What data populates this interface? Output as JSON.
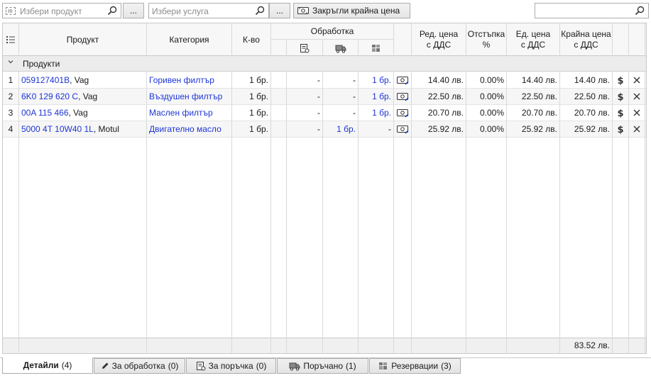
{
  "toolbar": {
    "product_placeholder": "Избери продукт",
    "product_browse_label": "...",
    "service_placeholder": "Избери услуга",
    "service_browse_label": "...",
    "round_price_label": "Закръгли крайна цена",
    "search_value": ""
  },
  "grid": {
    "headers": {
      "product": "Продукт",
      "category": "Категория",
      "qty": "К-во",
      "processing": "Обработка",
      "regular_price": "Ред. цена\nс ДДС",
      "discount": "Отстъпка\n%",
      "unit_price": "Ед. цена\nс ДДС",
      "final_price": "Крайна цена\nс ДДС"
    },
    "group_label": "Продукти",
    "rows": [
      {
        "num": "1",
        "code": "059127401B",
        "brand": ", Vag",
        "category": "Горивен филтър",
        "qty": "1 бр.",
        "proc1": "-",
        "proc2": "-",
        "proc3": "1 бр.",
        "proc3_link": true,
        "proc2_link": false,
        "regular": "14.40 лв.",
        "discount": "0.00%",
        "unit": "14.40 лв.",
        "final": "14.40 лв."
      },
      {
        "num": "2",
        "code": "6K0 129 620 C",
        "brand": ", Vag",
        "category": "Въздушен филтър",
        "qty": "1 бр.",
        "proc1": "-",
        "proc2": "-",
        "proc3": "1 бр.",
        "proc3_link": true,
        "proc2_link": false,
        "regular": "22.50 лв.",
        "discount": "0.00%",
        "unit": "22.50 лв.",
        "final": "22.50 лв."
      },
      {
        "num": "3",
        "code": "00A 115 466",
        "brand": ", Vag",
        "category": "Маслен филтър",
        "qty": "1 бр.",
        "proc1": "-",
        "proc2": "-",
        "proc3": "1 бр.",
        "proc3_link": true,
        "proc2_link": false,
        "regular": "20.70 лв.",
        "discount": "0.00%",
        "unit": "20.70 лв.",
        "final": "20.70 лв."
      },
      {
        "num": "4",
        "code": "5000 4T 10W40 1L",
        "brand": ", Motul",
        "category": "Двигателно масло",
        "qty": "1 бр.",
        "proc1": "-",
        "proc2": "1 бр.",
        "proc3": "-",
        "proc3_link": false,
        "proc2_link": true,
        "regular": "25.92 лв.",
        "discount": "0.00%",
        "unit": "25.92 лв.",
        "final": "25.92 лв."
      }
    ],
    "total": "83.52 лв."
  },
  "tabs": [
    {
      "label": "Детайли",
      "count": "(4)",
      "icon": "none",
      "active": true
    },
    {
      "label": "За обработка",
      "count": "(0)",
      "icon": "pencil-icon",
      "active": false
    },
    {
      "label": "За поръчка",
      "count": "(0)",
      "icon": "order-icon",
      "active": false
    },
    {
      "label": "Поръчано",
      "count": "(1)",
      "icon": "truck-icon",
      "active": false
    },
    {
      "label": "Резервации",
      "count": "(3)",
      "icon": "reservation-icon",
      "active": false
    }
  ],
  "colors": {
    "link": "#1d35d6",
    "header_bg": "#f7f7f7",
    "group_bg": "#ececec"
  }
}
